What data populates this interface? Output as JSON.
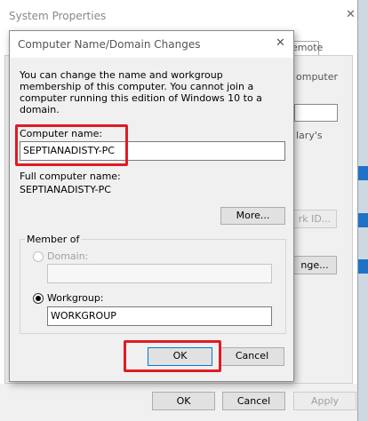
{
  "background_window": {
    "title": "System Properties",
    "close_glyph": "✕",
    "tab_fragment": "emote",
    "text_fragments": [
      "omputer",
      "lary's"
    ],
    "network_id_fragment": "rk ID...",
    "change_fragment": "nge...",
    "buttons": {
      "ok": "OK",
      "cancel": "Cancel",
      "apply": "Apply"
    }
  },
  "dialog": {
    "title": "Computer Name/Domain Changes",
    "close_glyph": "✕",
    "description": "You can change the name and workgroup membership of this computer. You cannot join a computer running this edition of Windows 10 to a domain.",
    "computer_name_label": "Computer name:",
    "computer_name_value": "SEPTIANADISTY-PC",
    "full_name_label": "Full computer name:",
    "full_name_value": "SEPTIANADISTY-PC",
    "more_button": "More...",
    "member_of": {
      "legend": "Member of",
      "domain_label": "Domain:",
      "domain_value": "",
      "workgroup_label": "Workgroup:",
      "workgroup_value": "WORKGROUP",
      "selected": "workgroup"
    },
    "ok_button": "OK",
    "cancel_button": "Cancel"
  },
  "colors": {
    "highlight": "#e01b24",
    "focus_border": "#0078d7",
    "disabled_text": "#a0a0a0"
  }
}
